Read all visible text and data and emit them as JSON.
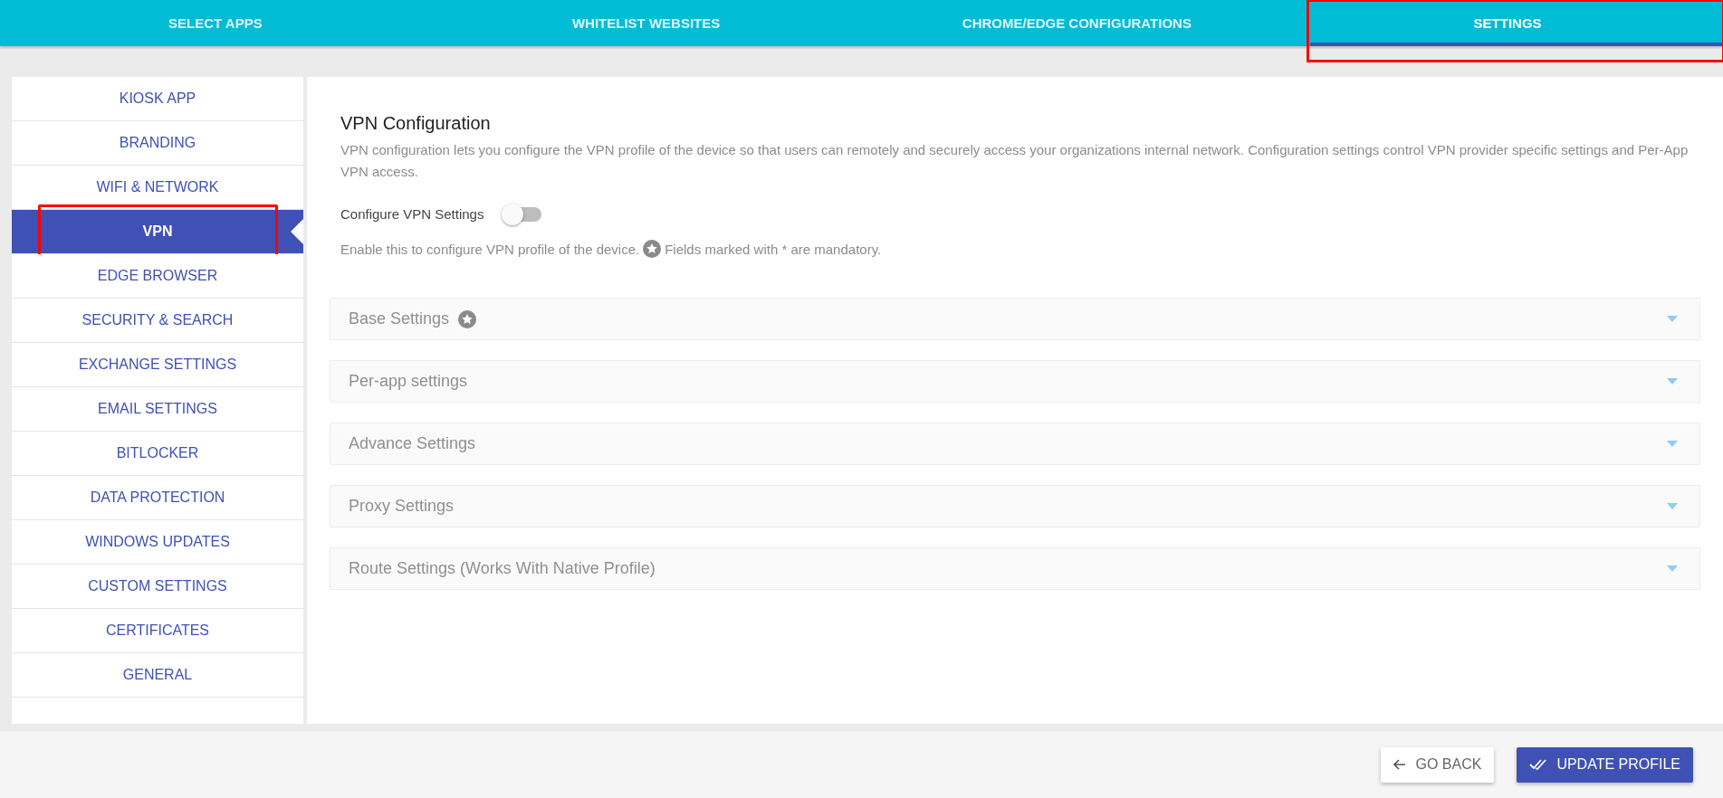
{
  "tabs": [
    {
      "label": "SELECT APPS",
      "selected": false,
      "highlighted": false
    },
    {
      "label": "WHITELIST WEBSITES",
      "selected": false,
      "highlighted": false
    },
    {
      "label": "CHROME/EDGE CONFIGURATIONS",
      "selected": false,
      "highlighted": false
    },
    {
      "label": "SETTINGS",
      "selected": true,
      "highlighted": true
    }
  ],
  "sidebar": {
    "items": [
      {
        "label": "KIOSK APP",
        "selected": false,
        "highlighted": false
      },
      {
        "label": "BRANDING",
        "selected": false,
        "highlighted": false
      },
      {
        "label": "WIFI & NETWORK",
        "selected": false,
        "highlighted": false
      },
      {
        "label": "VPN",
        "selected": true,
        "highlighted": true
      },
      {
        "label": "EDGE BROWSER",
        "selected": false,
        "highlighted": false
      },
      {
        "label": "SECURITY & SEARCH",
        "selected": false,
        "highlighted": false
      },
      {
        "label": "EXCHANGE SETTINGS",
        "selected": false,
        "highlighted": false
      },
      {
        "label": "EMAIL SETTINGS",
        "selected": false,
        "highlighted": false
      },
      {
        "label": "BITLOCKER",
        "selected": false,
        "highlighted": false
      },
      {
        "label": "DATA PROTECTION",
        "selected": false,
        "highlighted": false
      },
      {
        "label": "WINDOWS UPDATES",
        "selected": false,
        "highlighted": false
      },
      {
        "label": "CUSTOM SETTINGS",
        "selected": false,
        "highlighted": false
      },
      {
        "label": "CERTIFICATES",
        "selected": false,
        "highlighted": false
      },
      {
        "label": "GENERAL",
        "selected": false,
        "highlighted": false
      }
    ]
  },
  "content": {
    "title": "VPN Configuration",
    "description": "VPN configuration lets you configure the VPN profile of the device so that users can remotely and securely access your organizations internal network. Configuration settings control VPN provider specific settings and Per-App VPN access.",
    "toggle": {
      "label": "Configure VPN Settings",
      "on": false
    },
    "note_before": "Enable this to configure VPN profile of the device.",
    "note_after": "Fields marked with * are mandatory.",
    "sections": [
      {
        "title": "Base Settings",
        "mandatory": true,
        "expanded": false
      },
      {
        "title": "Per-app settings",
        "mandatory": false,
        "expanded": false
      },
      {
        "title": "Advance Settings",
        "mandatory": false,
        "expanded": false
      },
      {
        "title": "Proxy Settings",
        "mandatory": false,
        "expanded": false
      },
      {
        "title": "Route Settings (Works With Native Profile)",
        "mandatory": false,
        "expanded": false
      }
    ]
  },
  "footer": {
    "buttons": [
      {
        "label": "GO BACK",
        "kind": "back"
      },
      {
        "label": "UPDATE PROFILE",
        "kind": "primary"
      }
    ]
  }
}
